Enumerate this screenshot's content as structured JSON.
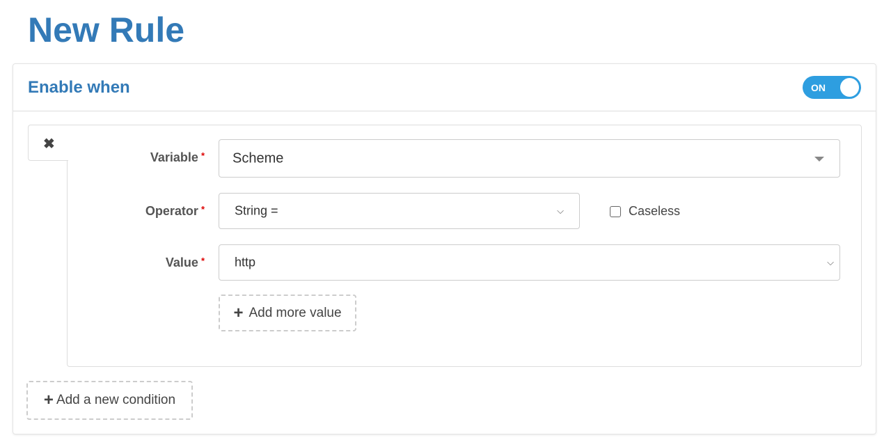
{
  "page": {
    "title": "New Rule"
  },
  "panel": {
    "heading": "Enable when",
    "toggle": {
      "label": "ON",
      "on": true,
      "color": "#2e9ee0"
    }
  },
  "condition": {
    "remove_icon": "close-icon",
    "variable": {
      "label": "Variable",
      "required": "*",
      "value": "Scheme"
    },
    "operator": {
      "label": "Operator",
      "required": "*",
      "value": "String ="
    },
    "caseless": {
      "label": "Caseless",
      "checked": false
    },
    "value": {
      "label": "Value",
      "required": "*",
      "value": "http"
    },
    "add_more_value": "Add more value"
  },
  "add_condition": "Add a new condition",
  "icons": {
    "plus": "+",
    "close": "✖",
    "chevron": "⌵"
  }
}
